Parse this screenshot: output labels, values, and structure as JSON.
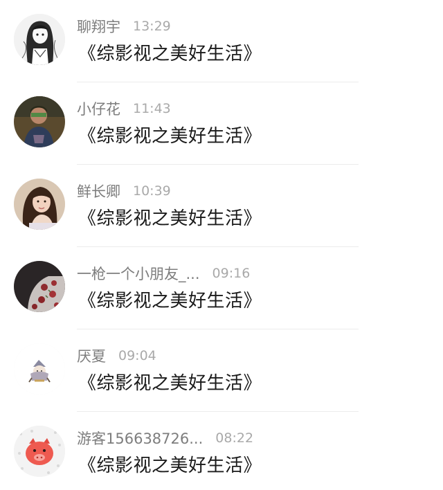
{
  "messages": [
    {
      "name": "聊翔宇",
      "time": "13:29",
      "text": "《综影视之美好生活》",
      "avatar": "anime-girl-sketch"
    },
    {
      "name": "小仔花",
      "time": "11:43",
      "text": "《综影视之美好生活》",
      "avatar": "person-photo"
    },
    {
      "name": "鲜长卿",
      "time": "10:39",
      "text": "《综影视之美好生活》",
      "avatar": "girl-portrait-photo"
    },
    {
      "name": "一枪一个小朋友_...",
      "time": "09:16",
      "text": "《综影视之美好生活》",
      "avatar": "floral-photo"
    },
    {
      "name": "厌夏",
      "time": "09:04",
      "text": "《综影视之美好生活》",
      "avatar": "cartoon-character"
    },
    {
      "name": "游客156638726...",
      "time": "08:22",
      "text": "《综影视之美好生活》",
      "avatar": "pink-pig"
    }
  ],
  "colors": {
    "name": "#7d7d7d",
    "time": "#a9a9a9",
    "text": "#1a1a1a",
    "divider": "#ececec"
  }
}
